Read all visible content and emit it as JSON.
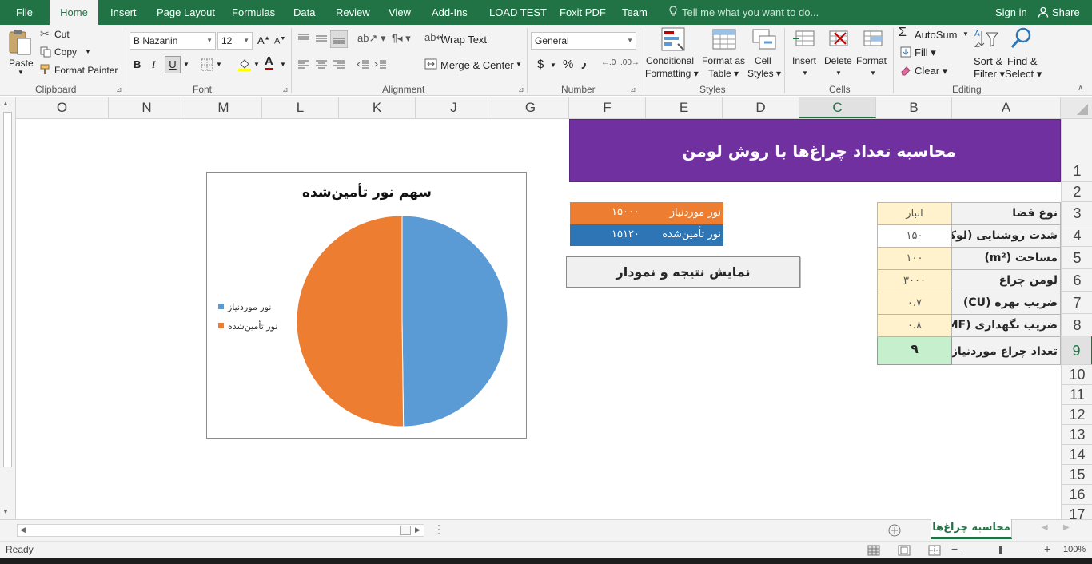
{
  "tabs": {
    "file": "File",
    "home": "Home",
    "insert": "Insert",
    "page_layout": "Page Layout",
    "formulas": "Formulas",
    "data": "Data",
    "review": "Review",
    "view": "View",
    "addins": "Add-Ins",
    "load_test": "LOAD TEST",
    "foxit": "Foxit PDF",
    "team": "Team",
    "tell_me": "Tell me what you want to do...",
    "sign_in": "Sign in",
    "share": "Share"
  },
  "clipboard": {
    "paste": "Paste",
    "cut": "Cut",
    "copy": "Copy",
    "format_painter": "Format Painter",
    "label": "Clipboard"
  },
  "font": {
    "name": "B Nazanin",
    "size": "12",
    "bold": "B",
    "italic": "I",
    "underline": "U",
    "font_color_glyph": "A",
    "label": "Font"
  },
  "alignment": {
    "wrap_text": "Wrap Text",
    "merge_center": "Merge & Center",
    "label": "Alignment"
  },
  "number": {
    "format": "General",
    "currency": "$",
    "percent": "%",
    "comma": "٫",
    "label": "Number"
  },
  "styles": {
    "conditional": "Conditional",
    "conditional2": "Formatting",
    "format_as": "Format as",
    "format_as2": "Table",
    "cell": "Cell",
    "cell2": "Styles",
    "label": "Styles"
  },
  "cells": {
    "insert": "Insert",
    "delete": "Delete",
    "format": "Format",
    "label": "Cells"
  },
  "editing": {
    "autosum": "AutoSum",
    "fill": "Fill",
    "clear": "Clear",
    "sort": "Sort &",
    "sort2": "Filter",
    "find": "Find &",
    "find2": "Select",
    "label": "Editing"
  },
  "columns": [
    "O",
    "N",
    "M",
    "L",
    "K",
    "J",
    "G",
    "F",
    "E",
    "D",
    "C",
    "B",
    "A"
  ],
  "rows": [
    "1",
    "2",
    "3",
    "4",
    "5",
    "6",
    "7",
    "8",
    "9",
    "10",
    "11",
    "12",
    "13",
    "14",
    "15",
    "16",
    "17"
  ],
  "sheet": {
    "title": "محاسبه تعداد چراغ‌ها با روش لومن",
    "inputs": [
      {
        "label": "نوع فضا",
        "value": "انبار"
      },
      {
        "label": "شدت روشنایی (لوکس)",
        "value": "۱۵۰"
      },
      {
        "label": "مساحت (m²)",
        "value": "۱۰۰"
      },
      {
        "label": "لومن چراغ",
        "value": "۳۰۰۰"
      },
      {
        "label": "ضریب بهره (CU)",
        "value": "۰.۷"
      },
      {
        "label": "ضریب نگهداری (MF)",
        "value": "۰.۸"
      }
    ],
    "result": {
      "label": "تعداد چراغ موردنیاز",
      "value": "۹"
    },
    "needed": {
      "label": "نور موردنیاز",
      "value": "۱۵۰۰۰"
    },
    "provided": {
      "label": "نور تأمین‌شده",
      "value": "۱۵۱۲۰"
    },
    "button": "نمایش نتیجه و نمودار"
  },
  "chart_data": {
    "type": "pie",
    "title": "سهم نور تأمین‌شده",
    "categories": [
      "نور موردنیاز",
      "نور تأمین‌شده"
    ],
    "values": [
      15000,
      15120
    ],
    "colors": [
      "#5b9bd5",
      "#ed7d31"
    ],
    "legend_position": "left"
  },
  "sheet_tab": "محاسبه چراغ‌ها",
  "status": {
    "ready": "Ready",
    "zoom": "100%"
  }
}
